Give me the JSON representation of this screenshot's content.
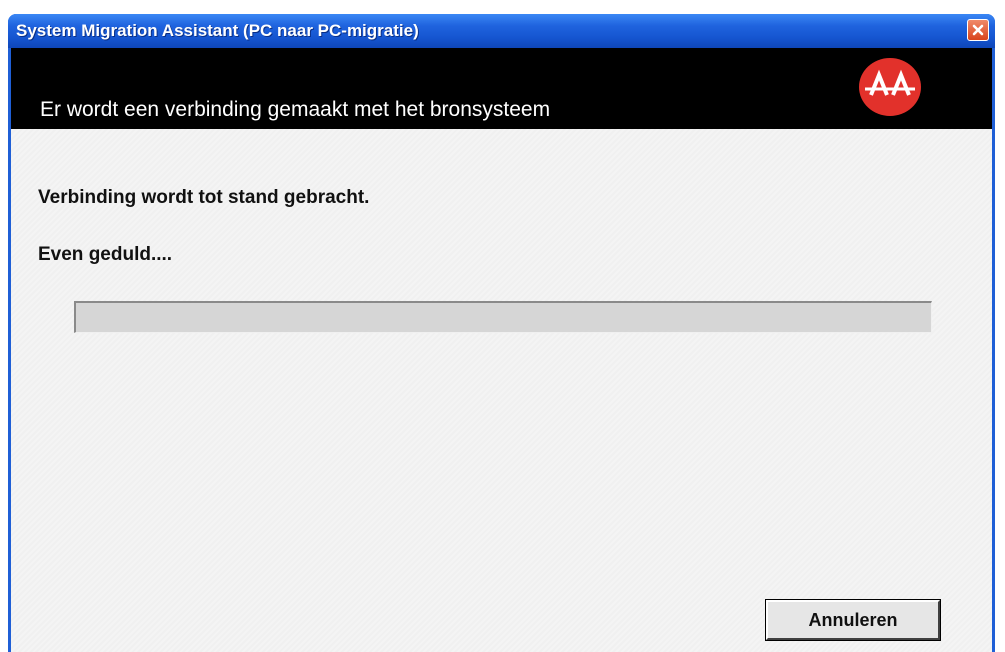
{
  "window": {
    "title": "System Migration Assistant (PC naar PC-migratie)",
    "close_icon": "close-icon",
    "colors": {
      "titlebar": "#1f5fd6",
      "close_button": "#d9441c",
      "banner": "#000000",
      "logo": "#e2312b"
    }
  },
  "banner": {
    "title": "Er wordt een verbinding gemaakt met het bronsysteem",
    "logo_icon": "bridge-logo-icon"
  },
  "main": {
    "status_text": "Verbinding wordt tot stand gebracht.",
    "wait_text": "Even geduld....",
    "progress": 0
  },
  "buttons": {
    "cancel_label": "Annuleren"
  }
}
